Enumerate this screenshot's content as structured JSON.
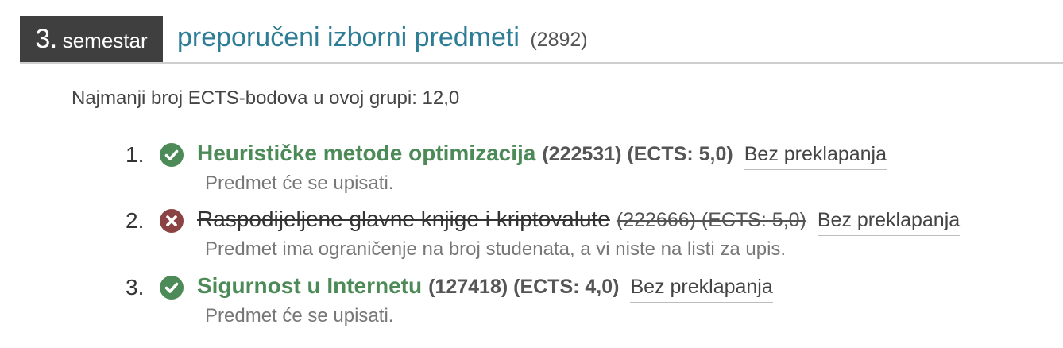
{
  "header": {
    "semester_number": "3.",
    "semester_word": "semestar",
    "group_title": "preporučeni izborni predmeti",
    "group_code": "(2892)"
  },
  "min_ects_text": "Najmanji broj ECTS-bodova u ovoj grupi: 12,0",
  "courses": [
    {
      "number": "1.",
      "status": "ok",
      "name": "Heurističke metode optimizacija",
      "meta": "(222531) (ECTS: 5,0)",
      "link": "Bez preklapanja",
      "note": "Predmet će se upisati."
    },
    {
      "number": "2.",
      "status": "rejected",
      "name": "Raspodijeljene glavne knjige i kriptovalute",
      "meta": "(222666) (ECTS: 5,0)",
      "link": "Bez preklapanja",
      "note": "Predmet ima ograničenje na broj studenata, a vi niste na listi za upis."
    },
    {
      "number": "3.",
      "status": "ok",
      "name": "Sigurnost u Internetu",
      "meta": "(127418) (ECTS: 4,0)",
      "link": "Bez preklapanja",
      "note": "Predmet će se upisati."
    }
  ],
  "icons": {
    "ok": "check-circle-icon",
    "rejected": "x-circle-icon"
  },
  "colors": {
    "accent_title": "#2e7d96",
    "ok_green": "#4c8a57",
    "rejected_red": "#8a4342",
    "badge_bg": "#3f3f3f"
  }
}
